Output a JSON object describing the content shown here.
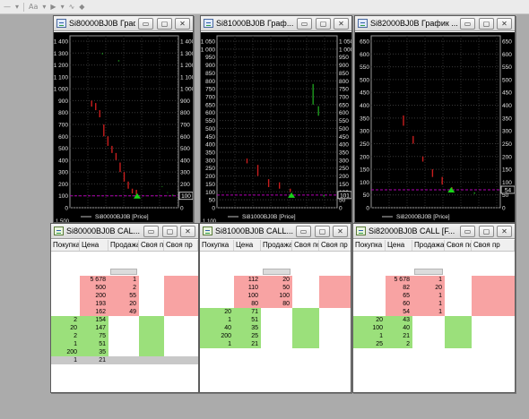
{
  "toolbar": {
    "items": [
      "—",
      "▾",
      "Aa",
      "▾",
      "▶",
      "▾",
      "∿",
      "◆"
    ]
  },
  "windows": [
    {
      "title": "Si80000BJ0B Граф...",
      "series_label": "Si80000BJ0B [Price]",
      "price_tag": "100",
      "ticks": [
        "1 400",
        "1 300",
        "1 200",
        "1 100",
        "1 000",
        "900",
        "800",
        "700",
        "600",
        "500",
        "400",
        "300",
        "200",
        "100",
        "0"
      ],
      "bottom_tick": "1 500"
    },
    {
      "title": "Si81000BJ0B Граф...",
      "series_label": "Si81000BJ0B [Price]",
      "price_tag": "101",
      "ticks": [
        "1 050",
        "1 000",
        "950",
        "900",
        "850",
        "800",
        "750",
        "700",
        "650",
        "600",
        "550",
        "500",
        "450",
        "400",
        "350",
        "300",
        "250",
        "200",
        "150",
        "100",
        "50",
        "0"
      ],
      "bottom_tick": "1 100"
    },
    {
      "title": "Si82000BJ0B График ...",
      "series_label": "Si82000BJ0B [Price]",
      "price_tag": "54",
      "ticks": [
        "650",
        "600",
        "550",
        "500",
        "450",
        "400",
        "350",
        "300",
        "250",
        "200",
        "150",
        "100",
        "50",
        "0"
      ],
      "bottom_tick": ""
    },
    {
      "title": "Si80000BJ0B CAL...",
      "columns": [
        "Покупка",
        "Цена",
        "Продажа",
        "Своя по",
        "Своя пр"
      ],
      "asks": [
        [
          "",
          "5 678",
          "1"
        ],
        [
          "",
          "500",
          "2"
        ],
        [
          "",
          "200",
          "55"
        ],
        [
          "",
          "193",
          "20"
        ],
        [
          "",
          "162",
          "49"
        ]
      ],
      "bids": [
        [
          "2",
          "154",
          ""
        ],
        [
          "20",
          "147",
          ""
        ],
        [
          "2",
          "75",
          ""
        ],
        [
          "1",
          "51",
          ""
        ],
        [
          "200",
          "35",
          ""
        ]
      ],
      "last": [
        "1",
        "21"
      ]
    },
    {
      "title": "Si81000BJ0B CALL...",
      "columns": [
        "Покупка",
        "Цена",
        "Продажа",
        "Своя по",
        "Своя пр"
      ],
      "asks": [
        [
          "",
          "112",
          "20"
        ],
        [
          "",
          "110",
          "50"
        ],
        [
          "",
          "100",
          "100"
        ],
        [
          "",
          "80",
          "80"
        ]
      ],
      "bids": [
        [
          "20",
          "71",
          ""
        ],
        [
          "1",
          "51",
          ""
        ],
        [
          "40",
          "35",
          ""
        ],
        [
          "200",
          "25",
          ""
        ],
        [
          "1",
          "21",
          ""
        ]
      ],
      "last": []
    },
    {
      "title": "Si82000BJ0B CALL [F...",
      "columns": [
        "Покупка",
        "Цена",
        "Продажа",
        "Своя по",
        "Своя пр"
      ],
      "asks": [
        [
          "",
          "5 678",
          "1"
        ],
        [
          "",
          "82",
          "20"
        ],
        [
          "",
          "65",
          "1"
        ],
        [
          "",
          "60",
          "1"
        ],
        [
          "",
          "54",
          "1"
        ]
      ],
      "bids": [
        [
          "20",
          "43",
          ""
        ],
        [
          "100",
          "40",
          ""
        ],
        [
          "1",
          "21",
          ""
        ],
        [
          "25",
          "2",
          ""
        ]
      ],
      "last": []
    }
  ],
  "window_buttons": {
    "min": "▭",
    "max": "▢",
    "close": "✕"
  },
  "colors": {
    "ask": "#f8a3a3",
    "bid": "#9be07b",
    "line": "#c81e1e",
    "line_green": "#1e9a1e",
    "level": "#b400b4"
  },
  "chart_series": [
    {
      "green_bars": [
        [
          1300,
          1290
        ],
        [
          1240,
          1230
        ],
        [
          180,
          175
        ],
        [
          130,
          125
        ],
        [
          110,
          100
        ]
      ],
      "red_bars": [
        [
          900,
          850
        ],
        [
          880,
          820
        ],
        [
          820,
          760
        ],
        [
          700,
          600
        ],
        [
          600,
          520
        ],
        [
          520,
          460
        ],
        [
          460,
          400
        ],
        [
          380,
          300
        ],
        [
          300,
          220
        ],
        [
          220,
          160
        ],
        [
          160,
          120
        ],
        [
          150,
          110
        ]
      ],
      "level": 100
    },
    {
      "green_bars": [
        [
          780,
          650
        ],
        [
          640,
          580
        ],
        [
          80,
          70
        ]
      ],
      "red_bars": [
        [
          310,
          280
        ],
        [
          270,
          200
        ],
        [
          180,
          130
        ],
        [
          160,
          120
        ],
        [
          120,
          100
        ]
      ],
      "level": 80
    },
    {
      "green_bars": [
        [
          60,
          54
        ]
      ],
      "red_bars": [
        [
          360,
          320
        ],
        [
          280,
          250
        ],
        [
          200,
          180
        ],
        [
          150,
          120
        ],
        [
          120,
          90
        ],
        [
          80,
          60
        ]
      ],
      "level": 70
    }
  ]
}
